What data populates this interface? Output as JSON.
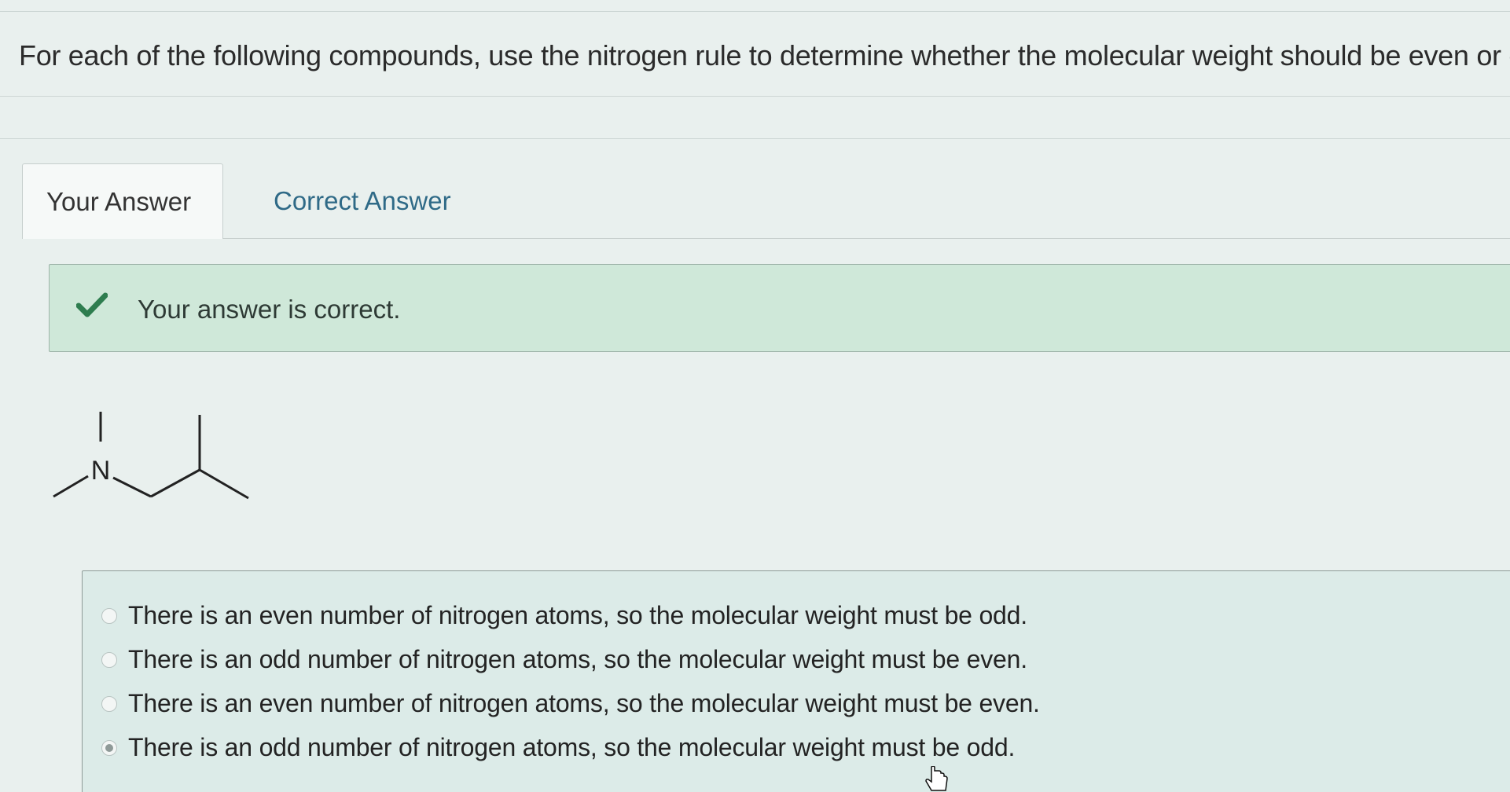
{
  "question": {
    "text": "For each of the following compounds, use the nitrogen rule to determine whether the molecular weight should be even or odd."
  },
  "tabs": [
    {
      "label": "Your Answer",
      "active": true
    },
    {
      "label": "Correct Answer",
      "active": false
    }
  ],
  "feedback": {
    "icon": "check-icon",
    "text": "Your answer is correct.",
    "color": "#2e7d4f"
  },
  "molecule": {
    "atom_label": "N"
  },
  "options": [
    {
      "label": "There is an even number of nitrogen atoms, so the molecular weight must be odd.",
      "selected": false
    },
    {
      "label": "There is an odd number of nitrogen atoms, so the molecular weight must be even.",
      "selected": false
    },
    {
      "label": "There is an even number of nitrogen atoms, so the molecular weight must be even.",
      "selected": false
    },
    {
      "label": "There is an odd number of nitrogen atoms, so the molecular weight must be odd.",
      "selected": true
    }
  ]
}
